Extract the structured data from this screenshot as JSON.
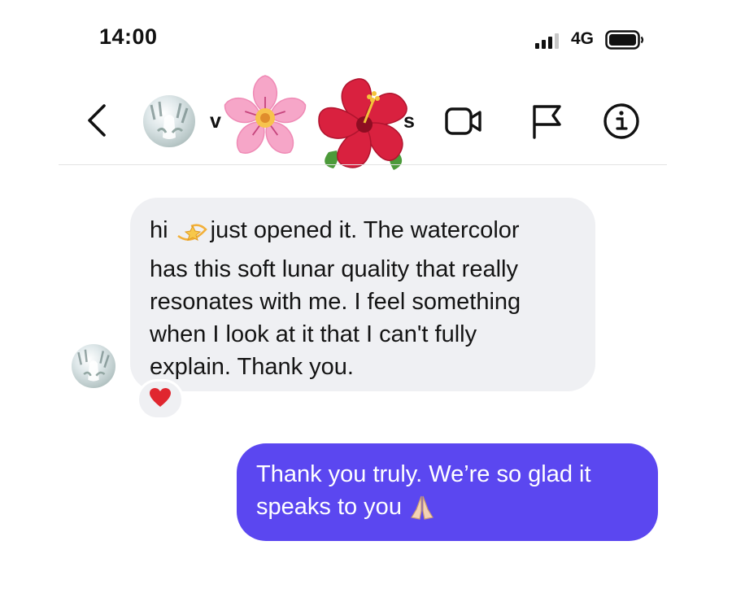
{
  "status_bar": {
    "time": "14:00",
    "network": "4G",
    "icons": [
      "signal-icon",
      "battery-icon"
    ]
  },
  "header": {
    "username_visible": "v",
    "username_tail": "s",
    "icons": [
      "chevron-left-icon",
      "video-camera-icon",
      "flag-icon",
      "info-icon"
    ],
    "stickers": [
      "cherry-blossom-sticker",
      "hibiscus-sticker"
    ]
  },
  "messages": [
    {
      "direction": "incoming",
      "lines": [
        "hi",
        "just opened it. The watercolor",
        "has this soft lunar quality that really",
        "resonates with me. I feel something",
        "when I look at it that I can't fully",
        "explain. Thank you."
      ],
      "inline_icon": "dizzy-star-icon",
      "reaction": "heart-icon"
    },
    {
      "direction": "outgoing",
      "lines": [
        "Thank you truly. We’re so glad it",
        "speaks to you"
      ],
      "inline_icon": "folded-hands-icon"
    }
  ],
  "colors": {
    "incoming_bubble": "#eff0f3",
    "outgoing_bubble": "#5b47f0",
    "reaction_heart": "#e0262f"
  }
}
